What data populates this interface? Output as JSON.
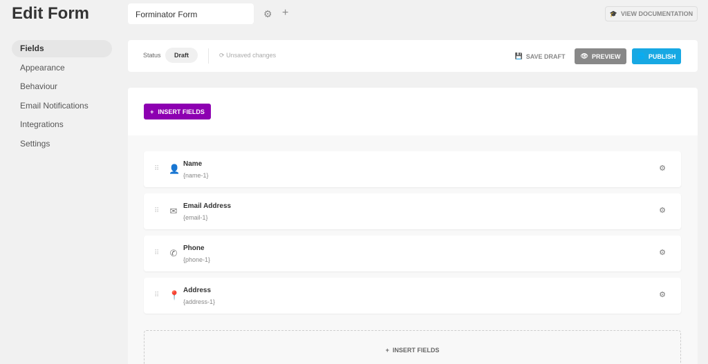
{
  "header": {
    "title": "Edit Form",
    "form_name": "Forminator Form",
    "view_docs": "VIEW DOCUMENTATION"
  },
  "sidebar": {
    "items": [
      {
        "label": "Fields",
        "active": true
      },
      {
        "label": "Appearance"
      },
      {
        "label": "Behaviour"
      },
      {
        "label": "Email Notifications"
      },
      {
        "label": "Integrations"
      },
      {
        "label": "Settings"
      }
    ]
  },
  "statusbar": {
    "status_label": "Status",
    "status_value": "Draft",
    "unsaved": "Unsaved changes",
    "save_draft": "SAVE DRAFT",
    "preview": "PREVIEW",
    "publish": "PUBLISH"
  },
  "colors": {
    "publish": "#17a8e3",
    "preview": "#888888",
    "insert": "#8d00b1"
  },
  "builder": {
    "insert_fields": "INSERT FIELDS",
    "bottom_insert": "INSERT FIELDS",
    "fields": [
      {
        "name": "Name",
        "id": "{name-1}",
        "icon": "user-icon"
      },
      {
        "name": "Email Address",
        "id": "{email-1}",
        "icon": "envelope-icon"
      },
      {
        "name": "Phone",
        "id": "{phone-1}",
        "icon": "phone-icon"
      },
      {
        "name": "Address",
        "id": "{address-1}",
        "icon": "map-pin-icon"
      }
    ]
  }
}
